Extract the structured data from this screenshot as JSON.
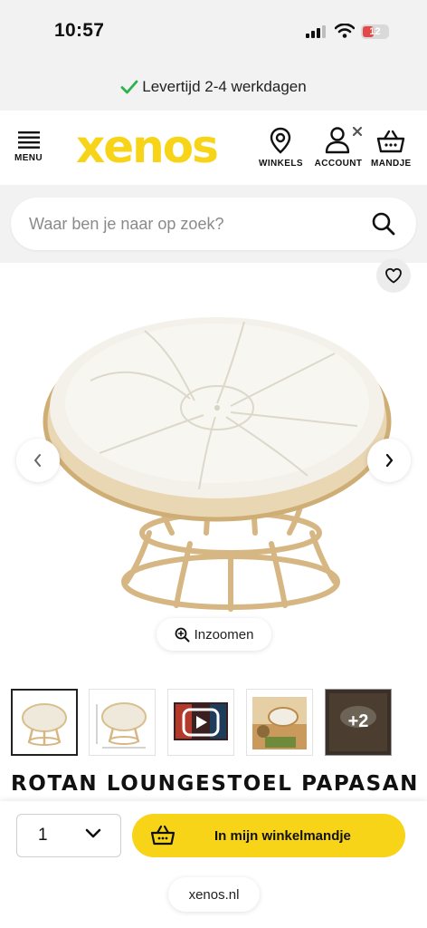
{
  "status_bar": {
    "time": "10:57",
    "battery": "12"
  },
  "banner": {
    "delivery_text": "Levertijd 2-4 werkdagen"
  },
  "header": {
    "menu_label": "MENU",
    "logo_text": "xenos",
    "stores_label": "WINKELS",
    "account_label": "ACCOUNT",
    "cart_label": "MANDJE"
  },
  "search": {
    "placeholder": "Waar ben je naar op zoek?"
  },
  "gallery": {
    "zoom_label": "Inzoomen",
    "more_count": "+2"
  },
  "product": {
    "title": "ROTAN LOUNGESTOEL PAPASAN -"
  },
  "purchase": {
    "quantity": "1",
    "add_to_cart_label": "In mijn winkelmandje"
  },
  "browser": {
    "domain": "xenos.nl"
  },
  "colors": {
    "brand_yellow": "#f7d417",
    "check_green": "#2bb24c"
  }
}
